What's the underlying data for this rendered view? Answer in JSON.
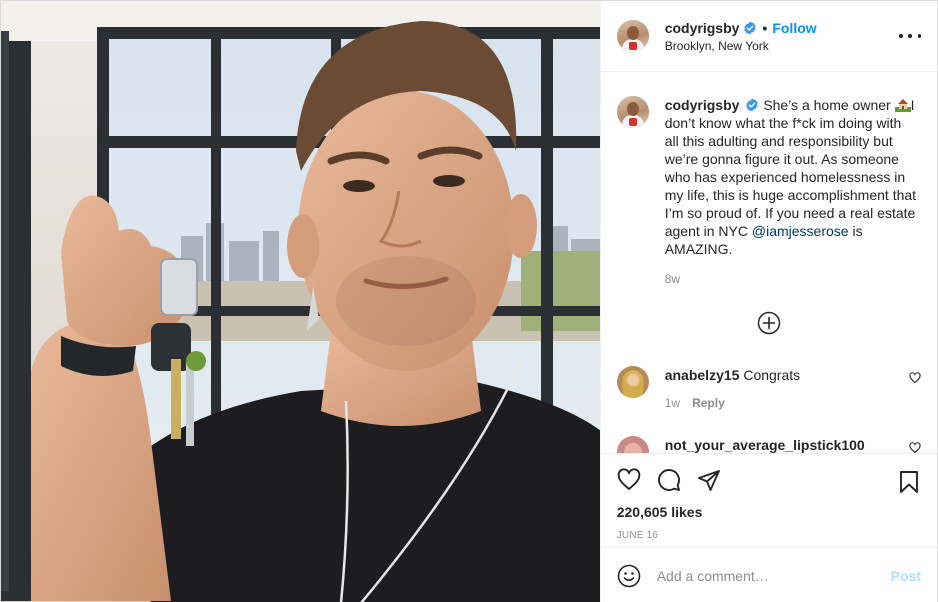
{
  "header": {
    "username": "cody​rigsby",
    "follow_label": "Follow",
    "separator": "•",
    "location": "Brooklyn, New York",
    "verified_icon": "verified-badge-icon",
    "more_icon": "more-options-icon"
  },
  "caption": {
    "username": "codyrigsby",
    "text_1": "She’s a home owner ",
    "text_2": "I don’t know what the f*ck im doing with all this adulting and responsibility but we’re gonna figure it out. As someone who has experienced homelessness in my life, this is huge accomplishment that I’m so proud of. If you need a real estate agent in NYC ",
    "mention": "@iamjesserose",
    "text_3": " is AMAZING.",
    "time": "8w",
    "emoji_icon": "house-with-garden-emoji"
  },
  "load_more_icon": "plus-circle-icon",
  "comments": [
    {
      "username": "anabelzy15",
      "text": "Congrats",
      "time": "1w",
      "reply_label": "Reply",
      "heart_icon": "heart-outline-icon"
    },
    {
      "username": "not_your_average_lipstick100",
      "text": "",
      "time": "",
      "reply_label": ""
    }
  ],
  "actions": {
    "like_icon": "heart-outline-icon",
    "comment_icon": "comment-bubble-icon",
    "share_icon": "paper-plane-icon",
    "save_icon": "bookmark-icon",
    "likes": "220,605 likes",
    "date": "JUNE 16"
  },
  "add_comment": {
    "placeholder": "Add a comment…",
    "post_label": "Post",
    "emoji_icon": "smiley-face-icon"
  },
  "colors": {
    "accent": "#0095f6",
    "mention": "#00376b",
    "muted": "#8e8e8e",
    "post_disabled": "#b2dffc"
  }
}
